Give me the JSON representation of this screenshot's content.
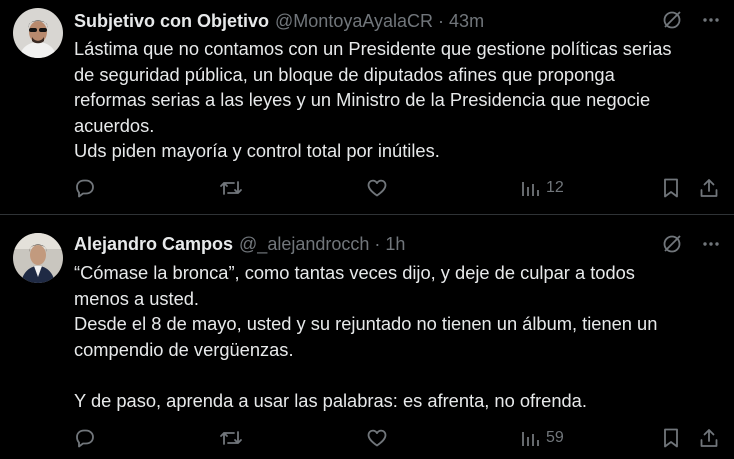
{
  "tweets": [
    {
      "author_name": "Subjetivo con Objetivo",
      "handle": "@MontoyaAyalaCR",
      "separator": "·",
      "time": "43m",
      "text_lines": [
        "Lástima que no contamos con un Presidente que gestione políticas serias",
        "de seguridad pública, un bloque de diputados afines que proponga",
        "reformas serias a las leyes y un Ministro de la Presidencia que negocie",
        "acuerdos.",
        "Uds piden mayoría y control total por inútiles."
      ],
      "views": "12"
    },
    {
      "author_name": "Alejandro Campos",
      "handle": "@_alejandrocch",
      "separator": "·",
      "time": "1h",
      "text_lines": [
        "“Cómase la bronca”, como tantas veces dijo, y deje de culpar a todos",
        "menos a usted.",
        "Desde el 8 de mayo, usted y su rejuntado no tienen un álbum, tienen un",
        "compendio de vergüenzas.",
        "",
        "Y de paso, aprenda a usar las palabras: es afrenta, no ofrenda."
      ],
      "views": "59"
    }
  ],
  "icons": {
    "reply": "reply-icon",
    "retweet": "retweet-icon",
    "like": "heart-icon",
    "views": "views-icon",
    "bookmark": "bookmark-icon",
    "share": "share-icon",
    "grok": "grok-icon",
    "more": "more-icon"
  },
  "colors": {
    "background": "#000000",
    "text": "#e7e9ea",
    "muted": "#71767b",
    "divider": "#2f3336"
  }
}
